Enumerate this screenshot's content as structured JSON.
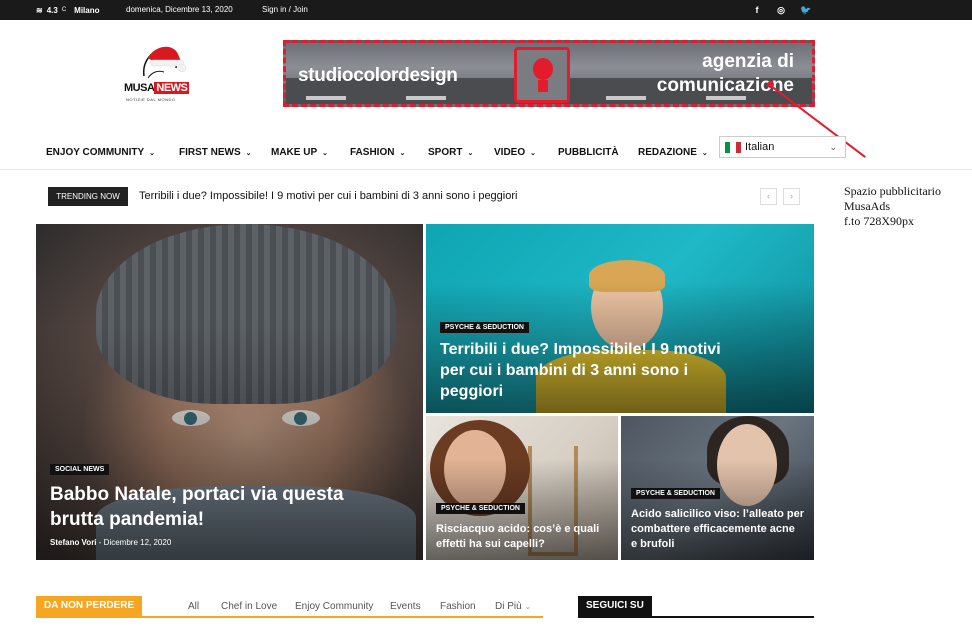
{
  "topbar": {
    "temperature": "4.3",
    "unit": "C",
    "city": "Milano",
    "date": "domenica, Dicembre 13, 2020",
    "signin": "Sign in / Join",
    "social": [
      {
        "icon": "facebook-icon",
        "glyph": "f"
      },
      {
        "icon": "instagram-icon",
        "glyph": "◎"
      },
      {
        "icon": "twitter-icon",
        "glyph": "🐦"
      }
    ]
  },
  "logo": {
    "name_left": "MUSA",
    "name_right": "NEWS",
    "tagline": "NOTIZIE DAL MONDO"
  },
  "ad": {
    "left_text": "studiocolordesign",
    "right_line1": "agenzia di",
    "right_line2": "comunicazione",
    "border_color": "#e21b2d"
  },
  "annotation": {
    "line1": "Spazio pubblicitario",
    "line2": "MusaAds",
    "line3": "f.to 728X90px"
  },
  "nav": {
    "items": [
      {
        "label": "ENJOY COMMUNITY",
        "dropdown": true
      },
      {
        "label": "FIRST NEWS",
        "dropdown": true
      },
      {
        "label": "MAKE UP",
        "dropdown": true
      },
      {
        "label": "FASHION",
        "dropdown": true
      },
      {
        "label": "SPORT",
        "dropdown": true
      },
      {
        "label": "VIDEO",
        "dropdown": true
      },
      {
        "label": "PUBBLICITÀ",
        "dropdown": false
      },
      {
        "label": "REDAZIONE",
        "dropdown": true
      }
    ],
    "language": "Italian"
  },
  "trending": {
    "label": "TRENDING NOW",
    "headline": "Terribili i due? Impossibile! I 9 motivi per cui i bambini di 3 anni sono i peggiori",
    "prev": "‹",
    "next": "›"
  },
  "grid": {
    "main": {
      "category": "SOCIAL NEWS",
      "title_line1": "Babbo Natale, portaci via questa",
      "title_line2": "brutta pandemia!",
      "author": "Stefano Vori",
      "separator": "-",
      "date": "Dicembre 12, 2020"
    },
    "top_right": {
      "category": "PSYCHE & SEDUCTION",
      "title_line1": "Terribili i due? Impossibile! I 9 motivi",
      "title_line2": "per cui i bambini di 3 anni sono i",
      "title_line3": "peggiori"
    },
    "bottom_left": {
      "category": "PSYCHE & SEDUCTION",
      "title_line1": "Risciacquo acido: cos’è e quali",
      "title_line2": "effetti ha sui capelli?"
    },
    "bottom_right": {
      "category": "PSYCHE & SEDUCTION",
      "title_line1": "Acido salicilico viso: l’alleato per",
      "title_line2": "combattere efficacemente acne",
      "title_line3": "e brufoli"
    }
  },
  "section": {
    "label": "DA NON PERDERE",
    "tabs": [
      "All",
      "Chef in Love",
      "Enjoy Community",
      "Events",
      "Fashion",
      "Di Più"
    ],
    "accent": "#f5a623"
  },
  "social_section": {
    "label": "SEGUICI SU"
  }
}
